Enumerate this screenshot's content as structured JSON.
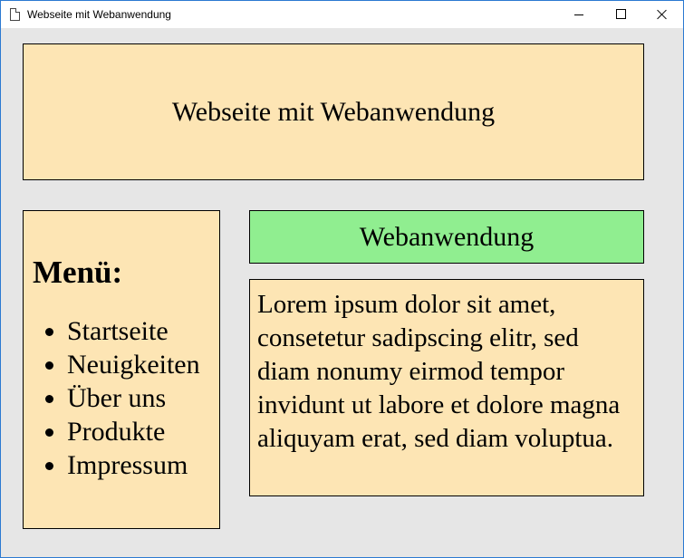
{
  "window": {
    "title": "Webseite mit Webanwendung",
    "icon": "document-icon",
    "controls": [
      "minimize-icon",
      "maximize-icon",
      "close-icon"
    ]
  },
  "header": {
    "title": "Webseite mit Webanwendung"
  },
  "menu": {
    "heading": "Menü:",
    "items": [
      {
        "label": "Startseite"
      },
      {
        "label": "Neuigkeiten"
      },
      {
        "label": "Über uns"
      },
      {
        "label": "Produkte"
      },
      {
        "label": "Impressum"
      }
    ]
  },
  "app": {
    "title": "Webanwendung",
    "text": "Lorem ipsum dolor sit amet, consetetur sadipscing elitr, sed diam nonumy eirmod tempor invidunt ut labore et dolore magna aliquyam erat, sed diam voluptua."
  },
  "colors": {
    "box_background": "#fde5b4",
    "app_title_background": "#90ee90",
    "page_background": "#e6e6e6",
    "window_border": "#2b79d1"
  }
}
